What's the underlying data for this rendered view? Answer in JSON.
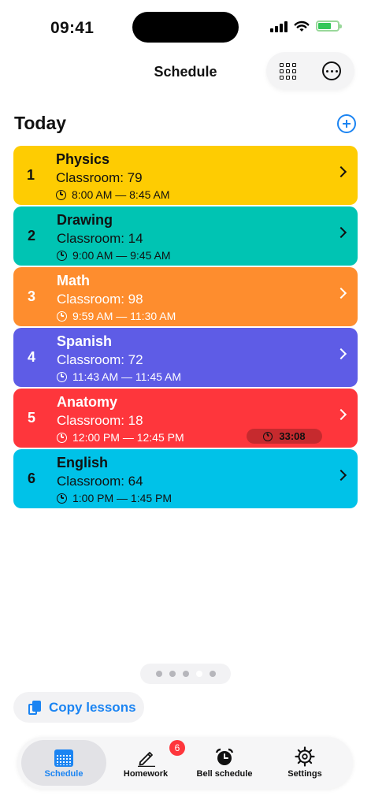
{
  "status_bar": {
    "time": "09:41"
  },
  "header": {
    "title": "Schedule"
  },
  "section": {
    "title": "Today"
  },
  "lessons": [
    {
      "number": "1",
      "subject": "Physics",
      "classroom": "Classroom: 79",
      "time": "8:00 AM — 8:45 AM",
      "color": "#fecc02"
    },
    {
      "number": "2",
      "subject": "Drawing",
      "classroom": "Classroom: 14",
      "time": "9:00 AM — 9:45 AM",
      "color": "#00c4b3"
    },
    {
      "number": "3",
      "subject": "Math",
      "classroom": "Classroom: 98",
      "time": "9:59 AM — 11:30 AM",
      "color": "#fe8d2e"
    },
    {
      "number": "4",
      "subject": "Spanish",
      "classroom": "Classroom: 72",
      "time": "11:43 AM — 11:45 AM",
      "color": "#5e5ce6"
    },
    {
      "number": "5",
      "subject": "Anatomy",
      "classroom": "Classroom: 18",
      "time": "12:00 PM — 12:45 PM",
      "color": "#fe363c",
      "timer": "33:08"
    },
    {
      "number": "6",
      "subject": "English",
      "classroom": "Classroom: 64",
      "time": "1:00 PM — 1:45 PM",
      "color": "#00c2e8"
    }
  ],
  "copy_button": {
    "label": "Copy lessons"
  },
  "tabbar": {
    "items": [
      {
        "label": "Schedule",
        "icon": "calendar-icon",
        "selected": true
      },
      {
        "label": "Homework",
        "icon": "pencil-icon",
        "badge": "6"
      },
      {
        "label": "Bell schedule",
        "icon": "alarm-clock-icon"
      },
      {
        "label": "Settings",
        "icon": "gear-icon"
      }
    ]
  },
  "colors": {
    "accent": "#1b84f2"
  }
}
